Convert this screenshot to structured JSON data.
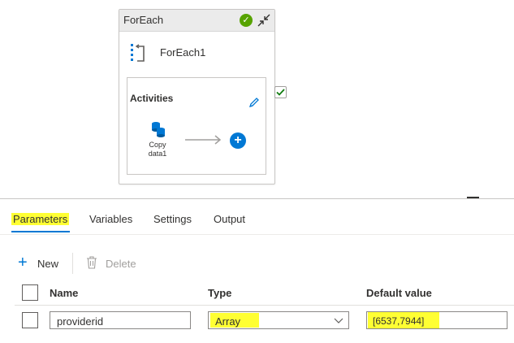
{
  "card": {
    "title": "ForEach",
    "activity_name": "ForEach1",
    "inner_title": "Activities",
    "copy_label_line1": "Copy",
    "copy_label_line2": "data1"
  },
  "tabs": [
    {
      "label": "Parameters",
      "active": true
    },
    {
      "label": "Variables",
      "active": false
    },
    {
      "label": "Settings",
      "active": false
    },
    {
      "label": "Output",
      "active": false
    }
  ],
  "toolbar": {
    "new_label": "New",
    "delete_label": "Delete"
  },
  "table": {
    "headers": [
      "Name",
      "Type",
      "Default value"
    ],
    "rows": [
      {
        "name": "providerid",
        "type": "Array",
        "default_value": "[6537,7944]"
      }
    ]
  },
  "colors": {
    "accent": "#0078d4",
    "success": "#57a300",
    "highlight": "#ffff33"
  }
}
